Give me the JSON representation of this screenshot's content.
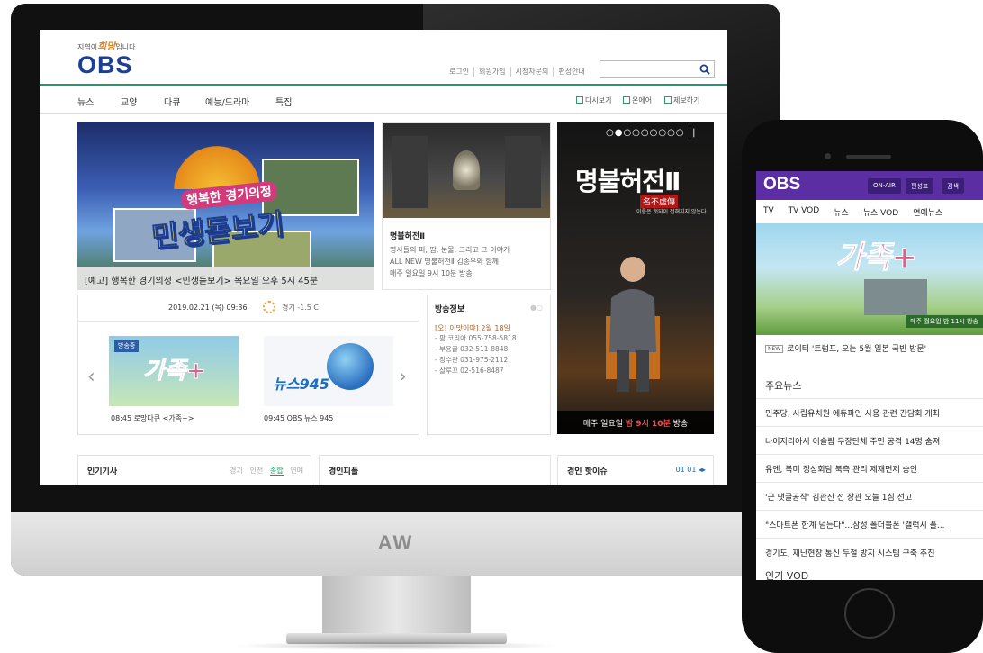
{
  "brand": "AW",
  "desktop": {
    "slogan_prefix": "지역이",
    "slogan_highlight": "희망",
    "slogan_suffix": "입니다",
    "logo": "OBS",
    "util": [
      "로그인",
      "회원가입",
      "시청자문의",
      "편성안내"
    ],
    "search_placeholder": "",
    "nav": [
      "뉴스",
      "교양",
      "다큐",
      "예능/드라마",
      "특집"
    ],
    "subnav": [
      "다시보기",
      "온에어",
      "제보하기"
    ],
    "hero_badge": "행복한 경기의정",
    "hero_title": "민생돋보기",
    "hero_caption": "[예고] 행복한 경기의정 <민생돋보기> 목요일 오후 5시 45분",
    "tile": {
      "title": "명불허전Ⅱ",
      "desc": [
        "명사들의 피, 땀, 눈물, 그리고 그 이야기",
        "ALL NEW 명불허전Ⅱ 김종우와 함께",
        "매주 일요일 9시 10분 방송"
      ]
    },
    "promo": {
      "dots": "○●○○○○○○○ ||",
      "title": "명불허전Ⅱ",
      "red": "名不虛傳",
      "sub": "이름은 헛되이 전해지지 않는다",
      "bottom_prefix": "매주 일요일",
      "bottom_highlight": "밤 9시 10분",
      "bottom_suffix": "방송"
    },
    "schedule": {
      "datetime": "2019.02.21 (목) 09:36",
      "weather": "경기 -1.5 C",
      "badge": "방송중",
      "thumb1_logo": "가족+",
      "thumb2_logo": "뉴스945",
      "cap1": "08:45  로망다큐 <가족+>",
      "cap2": "09:45  OBS 뉴스 945"
    },
    "binfo": {
      "title": "방송정보",
      "subtitle": "[오! 이맛이야] 2월 18일",
      "lines": [
        "- 팜 코리아 055-758-5818",
        "- 부용골 032-511-8848",
        "- 장수관 031-975-2112",
        "- 살루꼬 02-516-8487"
      ]
    },
    "bottom": {
      "popular": "인기기사",
      "popular_tabs": [
        "경기",
        "인천",
        "종합",
        "연예"
      ],
      "people": "경인피플",
      "issue": "경인 핫이슈",
      "issue_page": "01  01"
    }
  },
  "mobile": {
    "logo": "OBS",
    "buttons": [
      "ON-AIR",
      "편성표",
      "검색"
    ],
    "nav": [
      "TV",
      "TV VOD",
      "뉴스",
      "뉴스 VOD",
      "연예뉴스"
    ],
    "banner_logo": "가족+",
    "banner_ribbon": "매주 월요일 밤 11시 방송",
    "new_label": "NEW",
    "headline": "로이터 '트럼프, 오는 5월 일본 국빈 방문'",
    "section": "주요뉴스",
    "news": [
      "민주당, 사립유치원 에듀파인 사용 관련 간담회 개최",
      "나이지리아서 이슬람 무장단체 주민 공격 14명 숨져",
      "유엔, 북미 정상회담 북측 관리 제재면제 승인",
      "'군 댓글공작' 김관진 전 장관 오늘 1심 선고",
      "\"스마트폰 한계 넘는다\"...삼성 폴더블폰 '갤럭시 폴...",
      "경기도, 재난현장 통신 두절 방지 시스템 구축 추진"
    ],
    "vod": "인기 VOD"
  }
}
